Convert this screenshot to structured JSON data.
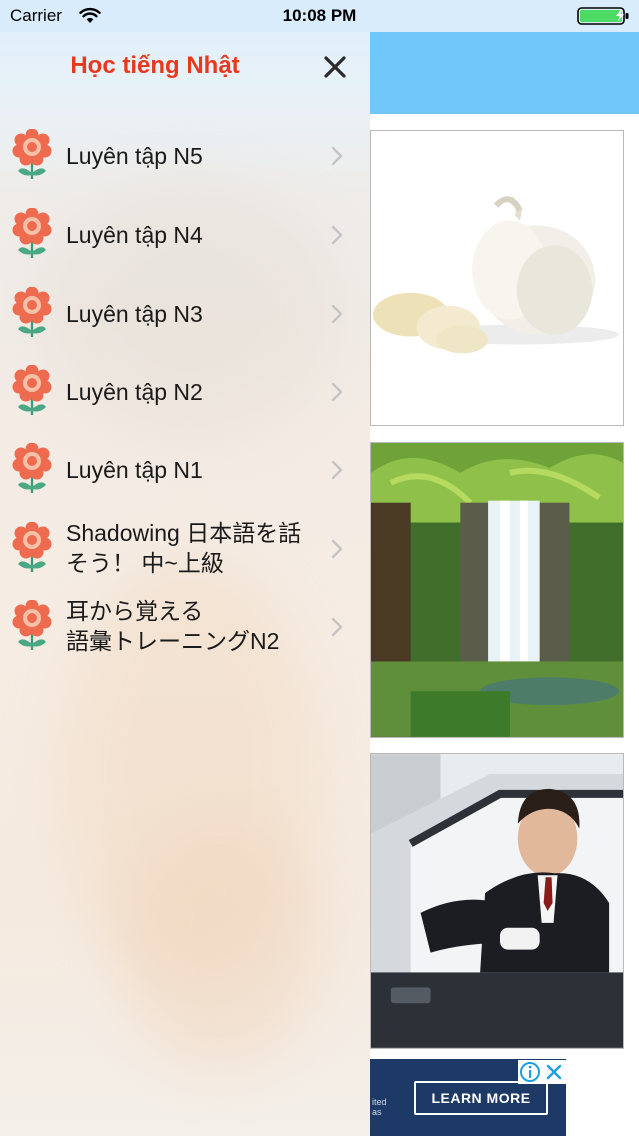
{
  "status_bar": {
    "carrier": "Carrier",
    "time": "10:08 PM",
    "icons": [
      "wifi-icon",
      "battery-charging-icon"
    ]
  },
  "drawer": {
    "title": "Học tiếng Nhật",
    "close_icon": "close-icon",
    "items": [
      {
        "label_lines": [
          "Luyên tập N5"
        ],
        "icon": "flower-icon"
      },
      {
        "label_lines": [
          "Luyên tập N4"
        ],
        "icon": "flower-icon"
      },
      {
        "label_lines": [
          "Luyên tập N3"
        ],
        "icon": "flower-icon"
      },
      {
        "label_lines": [
          "Luyên tập N2"
        ],
        "icon": "flower-icon"
      },
      {
        "label_lines": [
          "Luyên tập N1"
        ],
        "icon": "flower-icon"
      },
      {
        "label_lines": [
          "Shadowing 日本語を話",
          "そう！ 中~上級"
        ],
        "icon": "flower-icon"
      },
      {
        "label_lines": [
          "耳から覚える",
          "語彙トレーニングN2"
        ],
        "icon": "flower-icon"
      }
    ]
  },
  "background_content": {
    "cards": [
      "garlic-image",
      "waterfall-image",
      "man-in-car-image"
    ],
    "ad": {
      "cta": "LEARN MORE",
      "fine_print": "ited\nas",
      "icons": [
        "ad-info-icon",
        "ad-close-icon"
      ]
    }
  },
  "colors": {
    "title_red": "#e8391d",
    "header_blue": "#70c8fa",
    "flower_coral": "#ee6b4f",
    "battery_green": "#4cd964"
  }
}
